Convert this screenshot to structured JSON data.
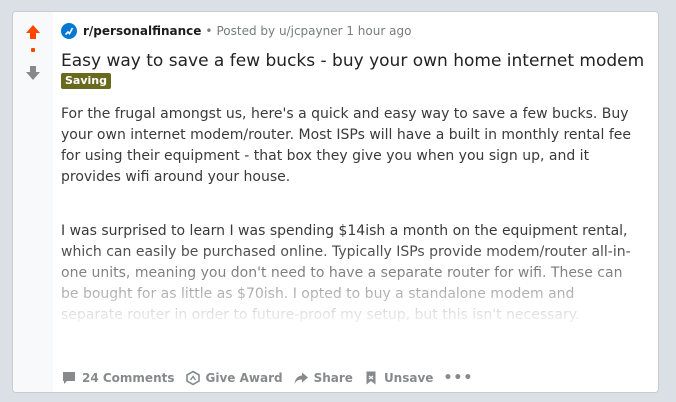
{
  "post": {
    "subreddit": "r/personalfinance",
    "separator": "•",
    "posted_by": "Posted by u/jcpayner 1 hour ago",
    "title": "Easy way to save a few bucks - buy your own home internet modem",
    "flair": "Saving",
    "body": [
      "For the frugal amongst us, here's a quick and easy way to save a few bucks. Buy your own internet modem/router. Most ISPs will have a built in monthly rental fee for using their equipment - that box they give you when you sign up, and it provides wifi around your house.",
      "I was surprised to learn I was spending $14ish a month on the equipment rental, which can easily be purchased online. Typically ISPs provide modem/router all-in-one units, meaning you don't need to have a separate router for wifi. These can be bought for as little as $70ish. I opted to buy a standalone modem and separate router in order to future-proof my setup, but this isn't necessary."
    ]
  },
  "actions": {
    "comments": "24 Comments",
    "award": "Give Award",
    "share": "Share",
    "unsave": "Unsave",
    "more": "•••"
  },
  "icons": {
    "upvote": "upvote-arrow-icon",
    "downvote": "downvote-arrow-icon",
    "subreddit": "subreddit-avatar-icon",
    "comments": "comment-bubble-icon",
    "award": "award-icon",
    "share": "share-arrow-icon",
    "unsave": "bookmark-icon"
  },
  "colors": {
    "upvote_active": "#ff4500",
    "flair_bg": "#6a6a1e",
    "subreddit_icon": "#0079d3"
  }
}
